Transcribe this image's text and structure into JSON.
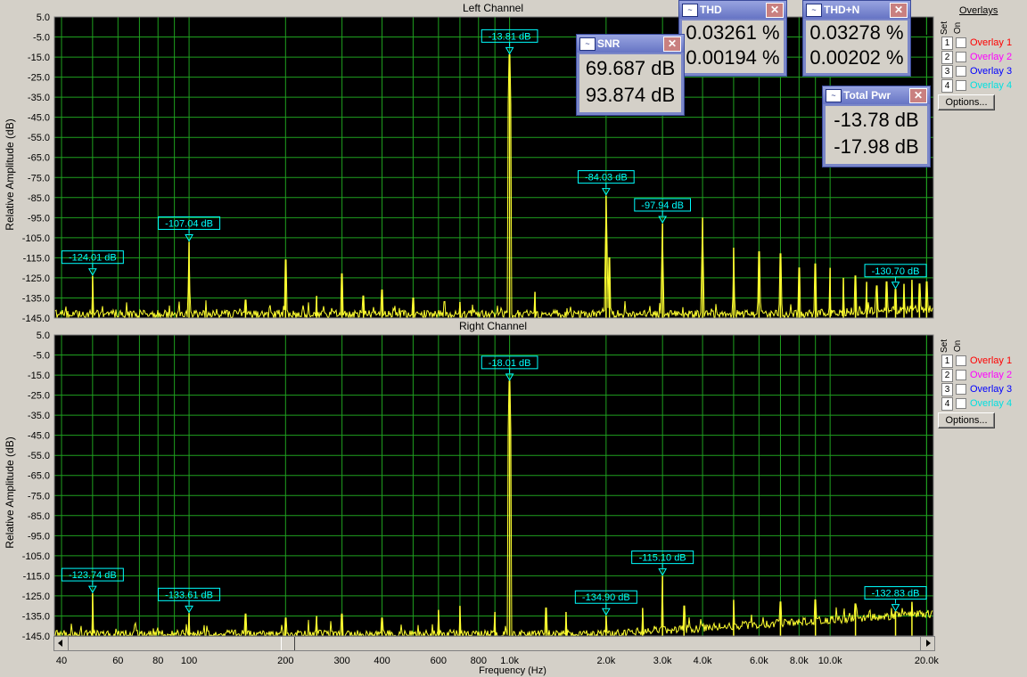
{
  "colors": {
    "plot_bg": "#000000",
    "grid": "#1fa01f",
    "trace": "#ffff30",
    "marker": "#00ffff",
    "marker_box": "#00ffff"
  },
  "icons": {
    "sine": "sine-wave-icon",
    "meter": "meter-icon",
    "close": "close-icon",
    "scroll_left": "left-arrow-icon",
    "scroll_right": "right-arrow-icon"
  },
  "overlays": {
    "heading": "Overlays",
    "set_label": "Set",
    "on_label": "On",
    "items": [
      {
        "num": "1",
        "label": "Overlay 1",
        "color": "#ff0000"
      },
      {
        "num": "2",
        "label": "Overlay 2",
        "color": "#ff00ff"
      },
      {
        "num": "3",
        "label": "Overlay 3",
        "color": "#0000ff"
      },
      {
        "num": "4",
        "label": "Overlay 4",
        "color": "#00e0e0"
      }
    ],
    "options_label": "Options..."
  },
  "meters": {
    "thd": {
      "title": "THD",
      "v1": "0.03261 %",
      "v2": "0.00194 %"
    },
    "thdn": {
      "title": "THD+N",
      "v1": "0.03278 %",
      "v2": "0.00202 %"
    },
    "snr": {
      "title": "SNR",
      "v1": "69.687 dB",
      "v2": "93.874 dB"
    },
    "pwr": {
      "title": "Total Pwr",
      "v1": "-13.78 dB",
      "v2": "-17.98 dB"
    }
  },
  "chart_data": [
    {
      "type": "line",
      "title": "Left Channel",
      "ylabel": "Relative Amplitude (dB)",
      "ylim": [
        -145,
        5
      ],
      "yticks": [
        "5.0",
        "-5.0",
        "-15.0",
        "-25.0",
        "-35.0",
        "-45.0",
        "-55.0",
        "-65.0",
        "-75.0",
        "-85.0",
        "-95.0",
        "-105.0",
        "-115.0",
        "-125.0",
        "-135.0",
        "-145.0"
      ],
      "xlim": [
        38,
        21000
      ],
      "xscale": "log",
      "noise_floor": -141,
      "series": [
        {
          "peaks": [
            {
              "x": 50,
              "y": -124.01
            },
            {
              "x": 100,
              "y": -107.04
            },
            {
              "x": 150,
              "y": -136
            },
            {
              "x": 200,
              "y": -116
            },
            {
              "x": 250,
              "y": -134
            },
            {
              "x": 300,
              "y": -123
            },
            {
              "x": 350,
              "y": -134
            },
            {
              "x": 400,
              "y": -131
            },
            {
              "x": 500,
              "y": -135
            },
            {
              "x": 700,
              "y": -137
            },
            {
              "x": 1000,
              "y": -13.81
            },
            {
              "x": 1200,
              "y": -132
            },
            {
              "x": 2000,
              "y": -84.03
            },
            {
              "x": 2050,
              "y": -115
            },
            {
              "x": 3000,
              "y": -97.94
            },
            {
              "x": 4000,
              "y": -95
            },
            {
              "x": 5000,
              "y": -110
            },
            {
              "x": 6000,
              "y": -112
            },
            {
              "x": 7000,
              "y": -113
            },
            {
              "x": 8000,
              "y": -120
            },
            {
              "x": 9000,
              "y": -118
            },
            {
              "x": 10000,
              "y": -120
            },
            {
              "x": 11000,
              "y": -125
            },
            {
              "x": 12000,
              "y": -124
            },
            {
              "x": 13000,
              "y": -127
            },
            {
              "x": 14000,
              "y": -129
            },
            {
              "x": 15000,
              "y": -127
            },
            {
              "x": 16000,
              "y": -130.7
            },
            {
              "x": 17000,
              "y": -128
            },
            {
              "x": 18000,
              "y": -126
            },
            {
              "x": 19000,
              "y": -128
            },
            {
              "x": 20000,
              "y": -127
            }
          ]
        }
      ],
      "markers": [
        {
          "x": 50,
          "y": -124.01,
          "label": "-124.01 dB"
        },
        {
          "x": 100,
          "y": -107.04,
          "label": "-107.04 dB"
        },
        {
          "x": 1000,
          "y": -13.81,
          "label": "-13.81 dB"
        },
        {
          "x": 2000,
          "y": -84.03,
          "label": "-84.03 dB"
        },
        {
          "x": 3000,
          "y": -97.94,
          "label": "-97.94 dB"
        },
        {
          "x": 16000,
          "y": -130.7,
          "label": "-130.70 dB"
        }
      ]
    },
    {
      "type": "line",
      "title": "Right Channel",
      "ylabel": "Relative Amplitude (dB)",
      "ylim": [
        -145,
        5
      ],
      "yticks": [
        "5.0",
        "-5.0",
        "-15.0",
        "-25.0",
        "-35.0",
        "-45.0",
        "-55.0",
        "-65.0",
        "-75.0",
        "-85.0",
        "-95.0",
        "-105.0",
        "-115.0",
        "-125.0",
        "-135.0",
        "-145.0"
      ],
      "xlim": [
        38,
        21000
      ],
      "xscale": "log",
      "noise_floor": -142,
      "xlabel": "Frequency (Hz)",
      "xticks": [
        {
          "v": 40,
          "t": "40"
        },
        {
          "v": 60,
          "t": "60"
        },
        {
          "v": 80,
          "t": "80"
        },
        {
          "v": 100,
          "t": "100"
        },
        {
          "v": 200,
          "t": "200"
        },
        {
          "v": 300,
          "t": "300"
        },
        {
          "v": 400,
          "t": "400"
        },
        {
          "v": 600,
          "t": "600"
        },
        {
          "v": 800,
          "t": "800"
        },
        {
          "v": 1000,
          "t": "1.0k"
        },
        {
          "v": 2000,
          "t": "2.0k"
        },
        {
          "v": 3000,
          "t": "3.0k"
        },
        {
          "v": 4000,
          "t": "4.0k"
        },
        {
          "v": 6000,
          "t": "6.0k"
        },
        {
          "v": 8000,
          "t": "8.0k"
        },
        {
          "v": 10000,
          "t": "10.0k"
        },
        {
          "v": 20000,
          "t": "20.0k"
        }
      ],
      "series": [
        {
          "peaks": [
            {
              "x": 50,
              "y": -123.74
            },
            {
              "x": 100,
              "y": -133.61
            },
            {
              "x": 150,
              "y": -134
            },
            {
              "x": 200,
              "y": -136
            },
            {
              "x": 250,
              "y": -135
            },
            {
              "x": 300,
              "y": -134
            },
            {
              "x": 400,
              "y": -136
            },
            {
              "x": 600,
              "y": -132
            },
            {
              "x": 700,
              "y": -130
            },
            {
              "x": 900,
              "y": -133
            },
            {
              "x": 1000,
              "y": -18.01
            },
            {
              "x": 1300,
              "y": -131
            },
            {
              "x": 1500,
              "y": -133
            },
            {
              "x": 2000,
              "y": -134.9
            },
            {
              "x": 2600,
              "y": -131
            },
            {
              "x": 3000,
              "y": -115.1
            },
            {
              "x": 3500,
              "y": -130
            },
            {
              "x": 5000,
              "y": -127
            },
            {
              "x": 7000,
              "y": -128
            },
            {
              "x": 9000,
              "y": -127
            },
            {
              "x": 12000,
              "y": -129
            },
            {
              "x": 16000,
              "y": -132.83
            },
            {
              "x": 18000,
              "y": -128
            }
          ]
        }
      ],
      "markers": [
        {
          "x": 50,
          "y": -123.74,
          "label": "-123.74 dB"
        },
        {
          "x": 100,
          "y": -133.61,
          "label": "-133.61 dB"
        },
        {
          "x": 1000,
          "y": -18.01,
          "label": "-18.01 dB"
        },
        {
          "x": 2000,
          "y": -134.9,
          "label": "-134.90 dB"
        },
        {
          "x": 3000,
          "y": -115.1,
          "label": "-115.10 dB"
        },
        {
          "x": 16000,
          "y": -132.83,
          "label": "-132.83 dB"
        }
      ]
    }
  ]
}
